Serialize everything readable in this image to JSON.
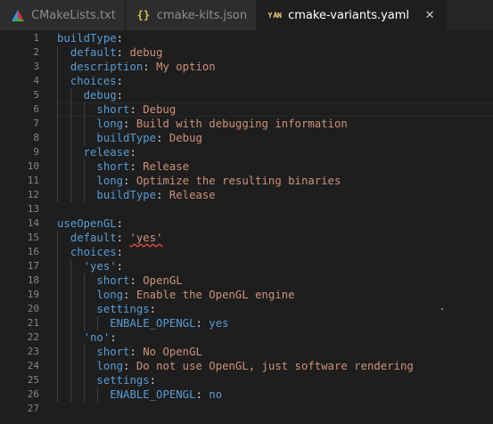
{
  "tabs": [
    {
      "label": "CMakeLists.txt",
      "icon": "cmake-triangle-icon",
      "active": false
    },
    {
      "label": "cmake-kits.json",
      "icon": "json-braces-icon",
      "active": false
    },
    {
      "label": "cmake-variants.yaml",
      "icon": "yaml-icon",
      "active": true,
      "close_symbol": "✕"
    }
  ],
  "editor": {
    "lines": [
      {
        "n": "1",
        "tokens": [
          [
            "k",
            "buildType"
          ],
          [
            "p",
            ":"
          ]
        ]
      },
      {
        "n": "2",
        "tokens": [
          [
            "p",
            "  "
          ],
          [
            "k",
            "default"
          ],
          [
            "p",
            ": "
          ],
          [
            "v",
            "debug"
          ]
        ]
      },
      {
        "n": "3",
        "tokens": [
          [
            "p",
            "  "
          ],
          [
            "k",
            "description"
          ],
          [
            "p",
            ": "
          ],
          [
            "v",
            "My option"
          ]
        ]
      },
      {
        "n": "4",
        "tokens": [
          [
            "p",
            "  "
          ],
          [
            "k",
            "choices"
          ],
          [
            "p",
            ":"
          ]
        ]
      },
      {
        "n": "5",
        "tokens": [
          [
            "p",
            "    "
          ],
          [
            "k",
            "debug"
          ],
          [
            "p",
            ":"
          ]
        ]
      },
      {
        "n": "6",
        "tokens": [
          [
            "p",
            "      "
          ],
          [
            "k",
            "short"
          ],
          [
            "p",
            ": "
          ],
          [
            "v",
            "Debug"
          ]
        ],
        "highlight": true
      },
      {
        "n": "7",
        "tokens": [
          [
            "p",
            "      "
          ],
          [
            "k",
            "long"
          ],
          [
            "p",
            ": "
          ],
          [
            "v",
            "Build with debugging information"
          ]
        ]
      },
      {
        "n": "8",
        "tokens": [
          [
            "p",
            "      "
          ],
          [
            "k",
            "buildType"
          ],
          [
            "p",
            ": "
          ],
          [
            "v",
            "Debug"
          ]
        ]
      },
      {
        "n": "9",
        "tokens": [
          [
            "p",
            "    "
          ],
          [
            "k",
            "release"
          ],
          [
            "p",
            ":"
          ]
        ]
      },
      {
        "n": "10",
        "tokens": [
          [
            "p",
            "      "
          ],
          [
            "k",
            "short"
          ],
          [
            "p",
            ": "
          ],
          [
            "v",
            "Release"
          ]
        ]
      },
      {
        "n": "11",
        "tokens": [
          [
            "p",
            "      "
          ],
          [
            "k",
            "long"
          ],
          [
            "p",
            ": "
          ],
          [
            "v",
            "Optimize the resulting binaries"
          ]
        ]
      },
      {
        "n": "12",
        "tokens": [
          [
            "p",
            "      "
          ],
          [
            "k",
            "buildType"
          ],
          [
            "p",
            ": "
          ],
          [
            "v",
            "Release"
          ]
        ]
      },
      {
        "n": "13",
        "tokens": []
      },
      {
        "n": "14",
        "tokens": [
          [
            "k",
            "useOpenGL"
          ],
          [
            "p",
            ":"
          ]
        ]
      },
      {
        "n": "15",
        "tokens": [
          [
            "p",
            "  "
          ],
          [
            "k",
            "default"
          ],
          [
            "p",
            ": "
          ],
          [
            "vs",
            "'yes'"
          ]
        ]
      },
      {
        "n": "16",
        "tokens": [
          [
            "p",
            "  "
          ],
          [
            "k",
            "choices"
          ],
          [
            "p",
            ":"
          ]
        ]
      },
      {
        "n": "17",
        "tokens": [
          [
            "p",
            "    "
          ],
          [
            "k",
            "'yes'"
          ],
          [
            "p",
            ":"
          ]
        ]
      },
      {
        "n": "18",
        "tokens": [
          [
            "p",
            "      "
          ],
          [
            "k",
            "short"
          ],
          [
            "p",
            ": "
          ],
          [
            "v",
            "OpenGL"
          ]
        ]
      },
      {
        "n": "19",
        "tokens": [
          [
            "p",
            "      "
          ],
          [
            "k",
            "long"
          ],
          [
            "p",
            ": "
          ],
          [
            "v",
            "Enable the OpenGL engine"
          ]
        ]
      },
      {
        "n": "20",
        "tokens": [
          [
            "p",
            "      "
          ],
          [
            "k",
            "settings"
          ],
          [
            "p",
            ":"
          ]
        ]
      },
      {
        "n": "21",
        "tokens": [
          [
            "p",
            "        "
          ],
          [
            "k",
            "ENBALE_OPENGL"
          ],
          [
            "p",
            ": "
          ],
          [
            "k",
            "yes"
          ]
        ]
      },
      {
        "n": "22",
        "tokens": [
          [
            "p",
            "    "
          ],
          [
            "k",
            "'no'"
          ],
          [
            "p",
            ":"
          ]
        ]
      },
      {
        "n": "23",
        "tokens": [
          [
            "p",
            "      "
          ],
          [
            "k",
            "short"
          ],
          [
            "p",
            ": "
          ],
          [
            "v",
            "No OpenGL"
          ]
        ]
      },
      {
        "n": "24",
        "tokens": [
          [
            "p",
            "      "
          ],
          [
            "k",
            "long"
          ],
          [
            "p",
            ": "
          ],
          [
            "v",
            "Do not use OpenGL, just software rendering"
          ]
        ]
      },
      {
        "n": "25",
        "tokens": [
          [
            "p",
            "      "
          ],
          [
            "k",
            "settings"
          ],
          [
            "p",
            ":"
          ]
        ]
      },
      {
        "n": "26",
        "tokens": [
          [
            "p",
            "        "
          ],
          [
            "k",
            "ENABLE_OPENGL"
          ],
          [
            "p",
            ": "
          ],
          [
            "k",
            "no"
          ]
        ]
      },
      {
        "n": "27",
        "tokens": []
      }
    ]
  },
  "colors": {
    "key": "#569cd6",
    "string": "#ce9178",
    "background": "#1e1e1e"
  }
}
